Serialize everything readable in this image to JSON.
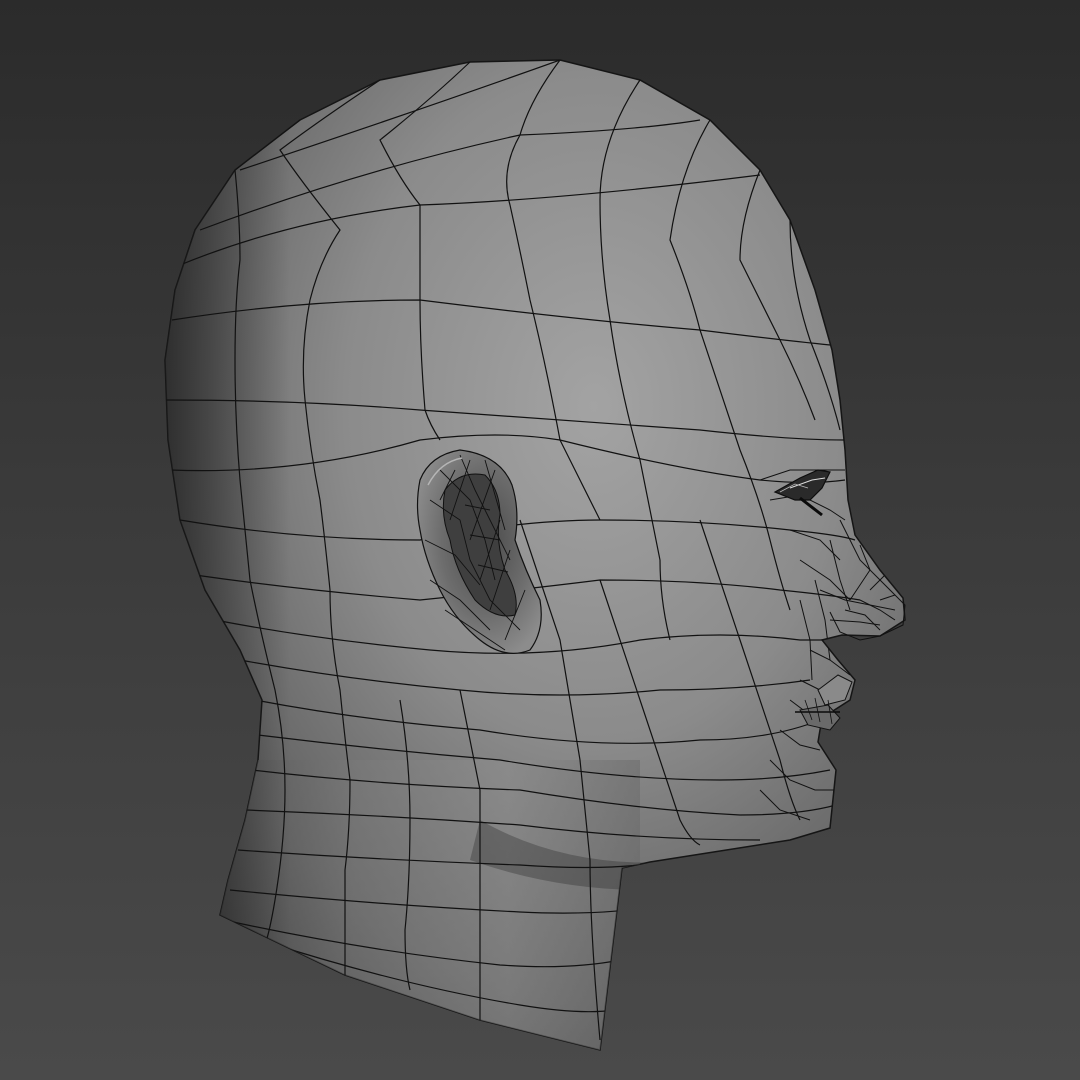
{
  "viewport": {
    "background_top": "#2b2b2b",
    "background_bottom": "#4a4a4a"
  },
  "model": {
    "subject": "head-wireframe",
    "shading": "flat-gray",
    "mesh_color": "#0f0f0f",
    "skin_light": "#9a9a9a",
    "skin_dark": "#3d3d3d"
  }
}
